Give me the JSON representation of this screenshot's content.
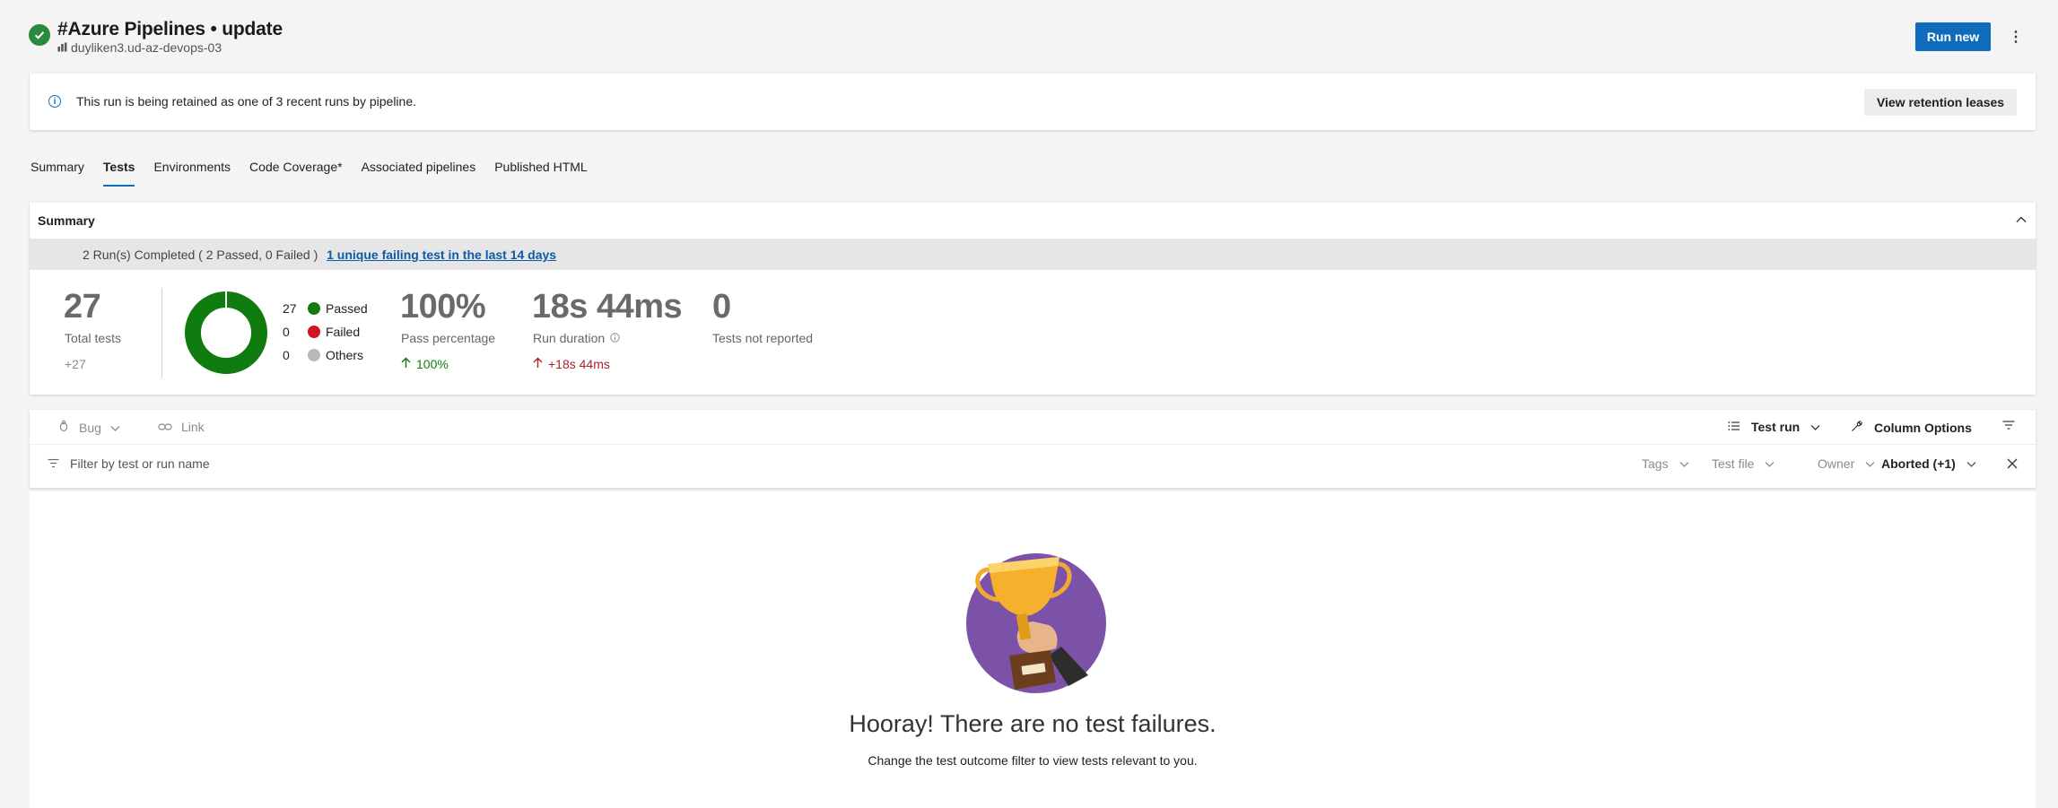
{
  "header": {
    "title": "#Azure Pipelines • update",
    "subtitle": "duyliken3.ud-az-devops-03",
    "run_new_label": "Run new",
    "more_label": "⋮"
  },
  "banner": {
    "text": "This run is being retained as one of 3 recent runs by pipeline.",
    "button_label": "View retention leases"
  },
  "tabs": [
    {
      "label": "Summary",
      "active": false
    },
    {
      "label": "Tests",
      "active": true
    },
    {
      "label": "Environments",
      "active": false
    },
    {
      "label": "Code Coverage*",
      "active": false
    },
    {
      "label": "Associated pipelines",
      "active": false
    },
    {
      "label": "Published HTML",
      "active": false
    }
  ],
  "summary": {
    "title": "Summary",
    "runs_text": "2 Run(s) Completed ( 2 Passed, 0 Failed )",
    "failing_link": "1 unique failing test in the last 14 days",
    "total_tests": "27",
    "total_label": "Total tests",
    "total_delta": "+27",
    "legend": [
      {
        "count": "27",
        "label": "Passed",
        "color": "#107c10"
      },
      {
        "count": "0",
        "label": "Failed",
        "color": "#d1151f"
      },
      {
        "count": "0",
        "label": "Others",
        "color": "#b9b9b9"
      }
    ],
    "pass_pct": "100%",
    "pass_label": "Pass percentage",
    "pass_delta": "100%",
    "duration": "18s 44ms",
    "duration_label": "Run duration",
    "duration_delta": "+18s 44ms",
    "not_reported": "0",
    "not_reported_label": "Tests not reported"
  },
  "toolbar": {
    "bug_label": "Bug",
    "link_label": "Link",
    "test_run_label": "Test run",
    "column_options_label": "Column Options",
    "filter_placeholder": "Filter by test or run name",
    "tags_label": "Tags",
    "test_file_label": "Test file",
    "owner_label": "Owner",
    "outcome_label": "Aborted (+1)"
  },
  "empty_state": {
    "title": "Hooray! There are no test failures.",
    "subtitle": "Change the test outcome filter to view tests relevant to you."
  },
  "colors": {
    "accent": "#0f6cbd",
    "success": "#107c10",
    "failure": "#d1151f",
    "trophy_bg": "#7b52a8"
  }
}
